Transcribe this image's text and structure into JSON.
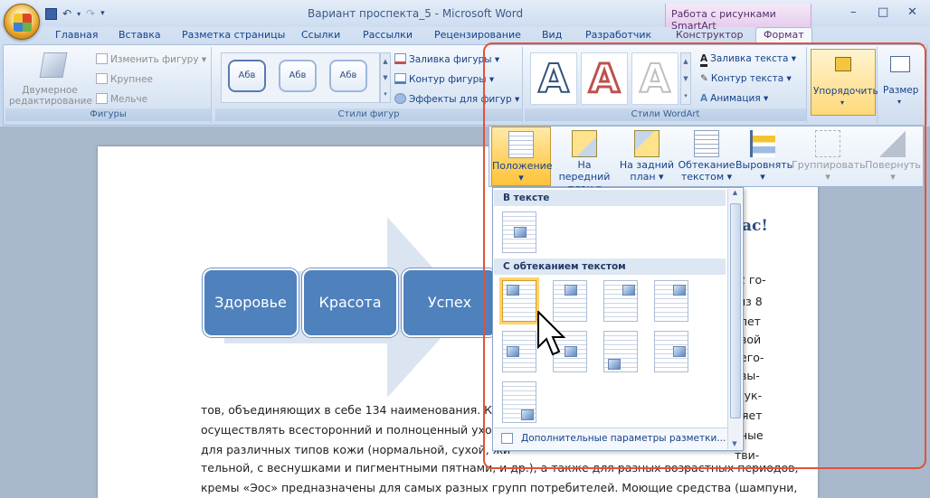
{
  "window": {
    "title": "Вариант проспекта_5 - Microsoft Word",
    "context_title": "Работа с рисунками SmartArt",
    "controls": [
      "–",
      "□",
      "✕"
    ]
  },
  "qat": {
    "save": "save-icon",
    "undo": "↶",
    "redo": "↷"
  },
  "tabs": [
    "Главная",
    "Вставка",
    "Разметка страницы",
    "Ссылки",
    "Рассылки",
    "Рецензирование",
    "Вид",
    "Разработчик",
    "Конструктор",
    "Формат"
  ],
  "ribbon": {
    "shapes_group": {
      "label": "Фигуры",
      "edit2d": "Двумерное\nредактирование",
      "edit2d_l1": "Двумерное",
      "edit2d_l2": "редактирование",
      "change_shape": "Изменить фигуру",
      "larger": "Крупнее",
      "smaller": "Мельче"
    },
    "shape_styles": {
      "label": "Стили фигур",
      "thumbs": [
        "Абв",
        "Абв",
        "Абв"
      ],
      "fill": "Заливка фигуры",
      "outline": "Контур фигуры",
      "effects": "Эффекты для фигур"
    },
    "wordart": {
      "label": "Стили WordArt",
      "letters": [
        "A",
        "A",
        "A"
      ],
      "text_fill": "Заливка текста",
      "text_outline": "Контур текста",
      "animation": "Анимация"
    },
    "arrange": "Упорядочить",
    "size": "Размер"
  },
  "arrange_panel": {
    "position": "Положение",
    "front_l1": "На передний",
    "front_l2": "план",
    "back_l1": "На задний",
    "back_l2": "план",
    "wrap_l1": "Обтекание",
    "wrap_l2": "текстом",
    "align": "Выровнять",
    "group": "Группировать",
    "rotate": "Повернуть"
  },
  "gallery": {
    "in_text": "В тексте",
    "with_wrap": "С обтеканием текстом",
    "more": "Дополнительные параметры разметки..."
  },
  "document": {
    "smartart": [
      "Здоровье",
      "Красота",
      "Успех"
    ],
    "heading_fragment": "ас!",
    "right_fragments": [
      "2 го-",
      "из 8",
      "лет",
      "вой",
      "его-",
      "вы-",
      "дук-",
      "ляет",
      "ные",
      "тви-"
    ],
    "lines": [
      "тов, объединяющих в себе 134  наименования. Кол",
      "осуществлять всесторонний и полноценный уход",
      "для различных типов кожи (нормальной, сухой, жи",
      "тельной, с веснушками и пигментными пятнами, и др.), а также для разных возрастных периодов,",
      "кремы «Эос» предназначены для самых разных групп потребителей. Моющие средства (шампуни,"
    ]
  },
  "colors": {
    "accent_red": "#e0533a",
    "smartart_blue": "#4f81bd",
    "selected": "#ffd46c"
  }
}
